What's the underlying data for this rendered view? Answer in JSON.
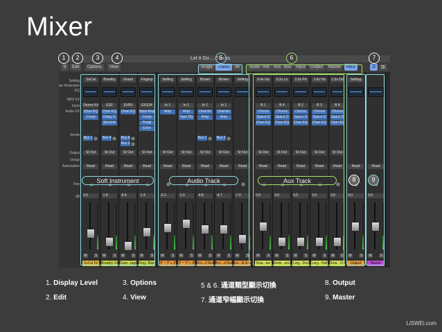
{
  "page_title": "Mixer",
  "mixer": {
    "window_title": "Let It Go ... Tracks",
    "toolbar": {
      "edit": "Edit",
      "options": "Options",
      "view": "View",
      "single": "Single",
      "tracks": "Tracks",
      "all": "All",
      "filters": [
        "Audio",
        "Inst",
        "Aux",
        "Bus",
        "Input",
        "Output",
        "Master",
        "MIDI"
      ]
    },
    "row_labels": [
      "Setting",
      "Gain Reduction",
      "EQ",
      "MIDI FX",
      "Input",
      "Audio FX",
      "Sends",
      "Output",
      "Group",
      "Automation",
      "Pan",
      "dB"
    ],
    "strips": [
      {
        "setting": "SoCal",
        "input": "Drums Kit",
        "fx": [
          "Chan EQ",
          "Comp"
        ],
        "sends": [
          "Bus 1"
        ],
        "output": "St Out",
        "automation": "Read",
        "db": "0.0",
        "name": "SoCal Kit",
        "color": "#e8c23a"
      },
      {
        "setting": "Breathy",
        "input": "ES2",
        "fx": [
          "Chan EQ",
          "Delay D",
          "SilvVerb"
        ],
        "sends": [
          "Bus 4"
        ],
        "output": "St Out",
        "automation": "Read",
        "db": "-1.8",
        "name": "Breathy Vox",
        "color": "#c7d64a"
      },
      {
        "setting": "Grand",
        "input": "EVB3",
        "fx": [
          "Chan EQ"
        ],
        "sends": [
          "Bus 8",
          "Bus 2"
        ],
        "output": "St Out",
        "automation": "Read",
        "db": "-9.4",
        "name": "Gran...tage",
        "color": "#c7d64a"
      },
      {
        "setting": "Fingerp",
        "input": "EXS24",
        "fx": [
          "Bass Amp",
          "Comp",
          "Pedal",
          "Echo"
        ],
        "sends": [],
        "output": "St Out",
        "automation": "Read",
        "db": "-1.4",
        "name": "Fing...Bass",
        "color": "#c7d64a"
      },
      {
        "setting": "Setting",
        "input": "In 1",
        "fx": [
          "Amp"
        ],
        "sends": [],
        "output": "St Out",
        "automation": "Read",
        "db": "-2.2",
        "name": "オーディオ 1",
        "color": "#e89a3a"
      },
      {
        "setting": "Setting",
        "input": "In 1",
        "fx": [
          "Amp",
          "Tape Dly"
        ],
        "sends": [],
        "output": "St Out",
        "automation": "Read",
        "db": "-1.3",
        "name": "オーディオ 2",
        "color": "#e89a3a"
      },
      {
        "setting": "Brown",
        "input": "In 1",
        "fx": [
          "Overdrv",
          "Amp"
        ],
        "sends": [
          "Bus 3"
        ],
        "output": "St Out",
        "automation": "Read",
        "db": "-4.8",
        "name": "Bro...il Dest",
        "color": "#e89a3a"
      },
      {
        "setting": "Brown",
        "input": "In 1",
        "fx": [
          "Overdrv",
          "Amp"
        ],
        "sends": [
          "Bus 2"
        ],
        "output": "St Out",
        "automation": "Read",
        "db": "-4.7",
        "name": "Bro...d Grat",
        "color": "#e89a3a"
      },
      {
        "setting": "Setting",
        "input": "",
        "fx": [],
        "sends": [],
        "output": "St Out",
        "automation": "Read",
        "db": "-7.0",
        "name": "Ins...lli Grat",
        "color": "#e89a3a"
      },
      {
        "setting": "0.4s Ga",
        "input": "B 1",
        "fx": [
          "Chorus",
          "Space D",
          "Chan EQ"
        ],
        "sends": [],
        "output": "St Out",
        "automation": "Read",
        "db": "0.0",
        "name": "Sma...ber",
        "color": "#d8e05a"
      },
      {
        "setting": "0.2s Lo",
        "input": "B 4",
        "fx": [
          "Chorus",
          "Space D",
          "Chan EQ"
        ],
        "sends": [],
        "output": "St Out",
        "automation": "Read",
        "db": "0.0",
        "name": "Ambi...ance",
        "color": "#d8e05a"
      },
      {
        "setting": "3.5s Pd",
        "input": "B 2",
        "fx": [
          "Chorus",
          "Space D",
          "Chan EQ"
        ],
        "sends": [],
        "output": "St Out",
        "automation": "Read",
        "db": "0.0",
        "name": "Larg...Dos",
        "color": "#d8e05a"
      },
      {
        "setting": "2.6s Ha",
        "input": "B 3",
        "fx": [
          "Chorus",
          "Space D",
          "Chan EQ"
        ],
        "sends": [],
        "output": "St Out",
        "automation": "Read",
        "db": "0.0",
        "name": "Larg...Hall",
        "color": "#d8e05a"
      },
      {
        "setting": "1.5s Dd",
        "input": "B 8",
        "fx": [
          "Chorus",
          "Space D",
          "Chan EQ"
        ],
        "sends": [],
        "output": "St Out",
        "automation": "Read",
        "db": "0.0",
        "name": "Sma...Vdl",
        "color": "#d8e05a"
      },
      {
        "setting": "Setting",
        "input": "",
        "fx": [],
        "sends": [],
        "output": "",
        "automation": "Read",
        "db": "0.0",
        "name": "Output",
        "color": "#e89a3a"
      },
      {
        "setting": "",
        "input": "",
        "fx": [],
        "sends": [],
        "output": "",
        "automation": "Read",
        "db": "0.0",
        "name": "Master",
        "color": "#c04ad8"
      }
    ],
    "sections": {
      "soft_instrument": "Soft Instrument",
      "audio_track": "Audio Track",
      "aux_track": "Aux Track"
    }
  },
  "badges": [
    "1",
    "2",
    "3",
    "4",
    "5",
    "6",
    "7",
    "8",
    "9"
  ],
  "legend": [
    {
      "num": "1.",
      "label": "Display Level"
    },
    {
      "num": "2.",
      "label": "Edit"
    },
    {
      "num": "3.",
      "label": "Options"
    },
    {
      "num": "4.",
      "label": "View"
    },
    {
      "num": "5 & 6.",
      "label": "通道類型顯示切換"
    },
    {
      "num": "7.",
      "label": "通道窄幅顯示切換"
    },
    {
      "num": "8.",
      "label": "Output"
    },
    {
      "num": "9.",
      "label": "Master"
    }
  ],
  "credit": "LiSWEi.com"
}
